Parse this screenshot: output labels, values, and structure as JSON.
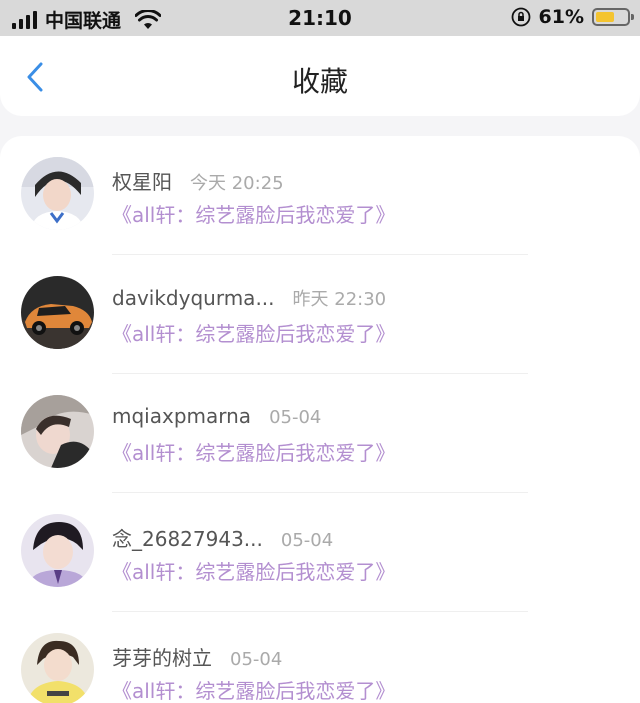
{
  "status_bar": {
    "carrier": "中国联通",
    "time": "21:10",
    "battery_percent": "61%",
    "battery_level": 0.61,
    "icons": [
      "signal-icon",
      "wifi-icon",
      "orientation-lock-icon",
      "battery-icon"
    ]
  },
  "header": {
    "title": "收藏",
    "back_icon": "chevron-left-icon"
  },
  "colors": {
    "accent_purple": "#b38fd0",
    "back_blue": "#3a8ee6",
    "battery_yellow": "#f4c430"
  },
  "items": [
    {
      "name": "权星阳",
      "time": "今天 20:25",
      "collection": "《all轩：综艺露脸后我恋爱了》"
    },
    {
      "name": "davikdyqurma...",
      "time": "昨天 22:30",
      "collection": "《all轩：综艺露脸后我恋爱了》"
    },
    {
      "name": "mqiaxpmarna",
      "time": "05-04",
      "collection": "《all轩：综艺露脸后我恋爱了》"
    },
    {
      "name": "念_26827943...",
      "time": "05-04",
      "collection": "《all轩：综艺露脸后我恋爱了》"
    },
    {
      "name": "芽芽的树立",
      "time": "05-04",
      "collection": "《all轩：综艺露脸后我恋爱了》"
    }
  ]
}
